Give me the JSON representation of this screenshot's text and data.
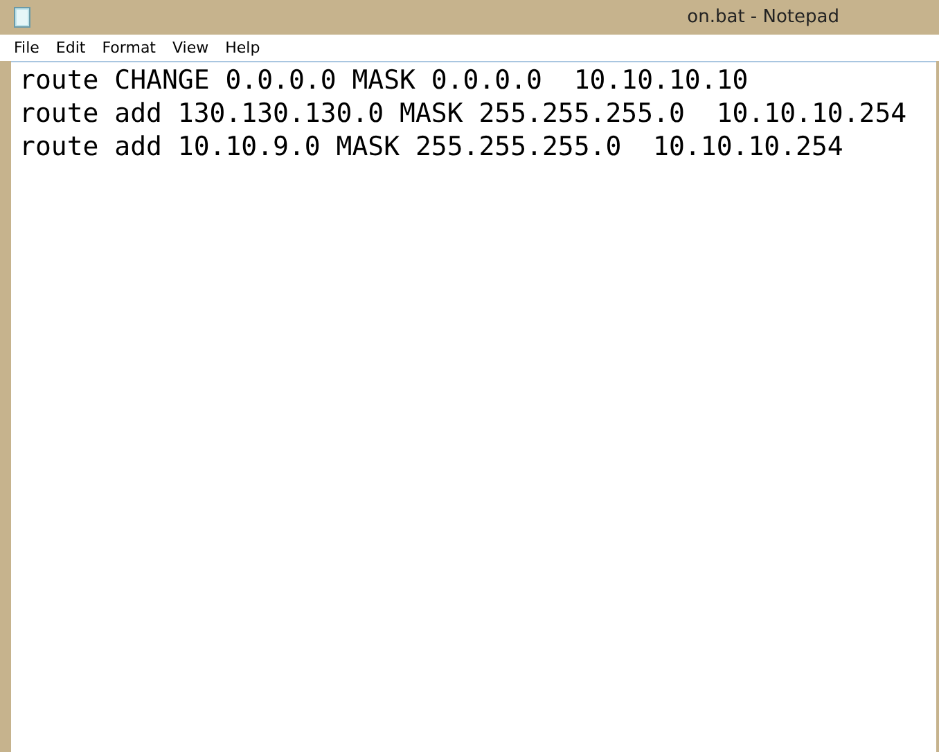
{
  "window": {
    "title": "on.bat - Notepad"
  },
  "menu": [
    "File",
    "Edit",
    "Format",
    "View",
    "Help"
  ],
  "editor": {
    "lines": [
      "route CHANGE 0.0.0.0 MASK 0.0.0.0  10.10.10.10",
      "route add 130.130.130.0 MASK 255.255.255.0  10.10.10.254",
      "route add 10.10.9.0 MASK 255.255.255.0  10.10.10.254"
    ]
  }
}
